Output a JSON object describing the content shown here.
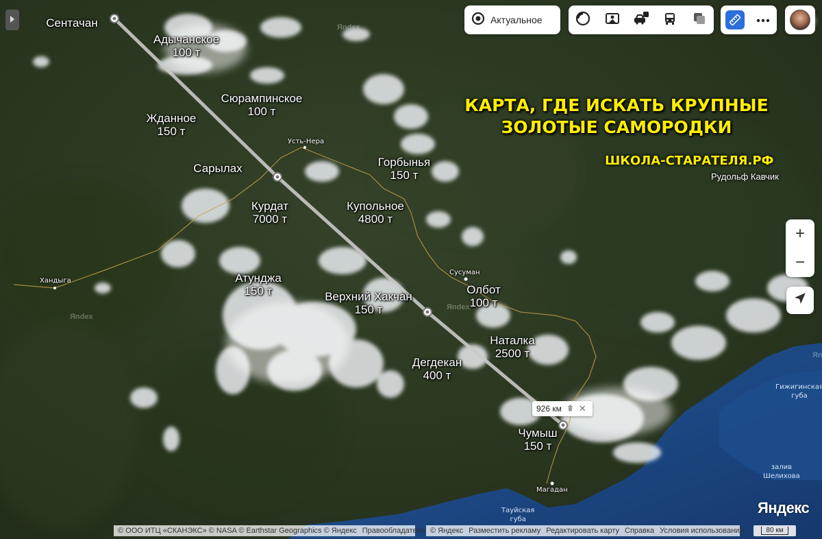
{
  "map": {
    "type": "satellite",
    "provider_logo": "Яндекс",
    "watermark": "Яndex",
    "distance_readout": "926 км",
    "scale_label": "80 км",
    "route_points_count": 4
  },
  "overlay": {
    "title_line1": "КАРТА, ГДЕ ИСКАТЬ КРУПНЫЕ",
    "title_line2": "ЗОЛОТЫЕ САМОРОДКИ",
    "site": "ШКОЛА-СТАРАТЕЛЯ.РФ",
    "author": "Рудольф Кавчик"
  },
  "deposits": [
    {
      "name": "Сентачан",
      "amount": ""
    },
    {
      "name": "Адычанское",
      "amount": "100 т"
    },
    {
      "name": "Сюрампинское",
      "amount": "100 т"
    },
    {
      "name": "Жданное",
      "amount": "150 т"
    },
    {
      "name": "Сарылах",
      "amount": ""
    },
    {
      "name": "Горбынья",
      "amount": "150 т"
    },
    {
      "name": "Курдат",
      "amount": "7000 т"
    },
    {
      "name": "Купольное",
      "amount": "4800 т"
    },
    {
      "name": "Атунджа",
      "amount": "150 т"
    },
    {
      "name": "Верхний Хакчан",
      "amount": "150 т"
    },
    {
      "name": "Олбот",
      "amount": "100 т"
    },
    {
      "name": "Наталка",
      "amount": "2500 т"
    },
    {
      "name": "Дегдекан",
      "amount": "400 т"
    },
    {
      "name": "Чумыш",
      "amount": "150 т"
    }
  ],
  "towns": [
    "Усть-Нера",
    "Хандыга",
    "Сусуман",
    "Магадан"
  ],
  "water": {
    "gizhiginskaya_line1": "Гижигинская",
    "gizhiginskaya_line2": "губа",
    "shelikhov_line1": "залив",
    "shelikhov_line2": "Шелихова",
    "tauyskaya_line1": "Тауйская",
    "tauyskaya_line2": "губа"
  },
  "toolbar": {
    "actual_label": "Актуальное",
    "icons": [
      "layers-icon",
      "panorama-icon",
      "traffic-icon",
      "transport-icon",
      "map-mode-icon"
    ],
    "ruler_icon": "ruler-icon",
    "more_icon": "more-icon"
  },
  "controls": {
    "zoom_in": "+",
    "zoom_out": "−",
    "location_icon": "location-arrow-icon",
    "sidebar_toggle_icon": "chevron-right-icon"
  },
  "footer": {
    "attribution": "© ООО ИТЦ «СКАНЭКС» © NASA © Earthstar Geographics © Яндекс",
    "rights_holders": "Правообладатели",
    "links": [
      "© Яндекс",
      "Разместить рекламу",
      "Редактировать карту",
      "Справка",
      "Условия использования"
    ]
  },
  "colors": {
    "title": "#ffee00",
    "route": "#c9c9c9",
    "sea": "#1e4f8f",
    "land": "#2d3a22",
    "snow": "#e8ecef",
    "border": "#c7a14a"
  }
}
